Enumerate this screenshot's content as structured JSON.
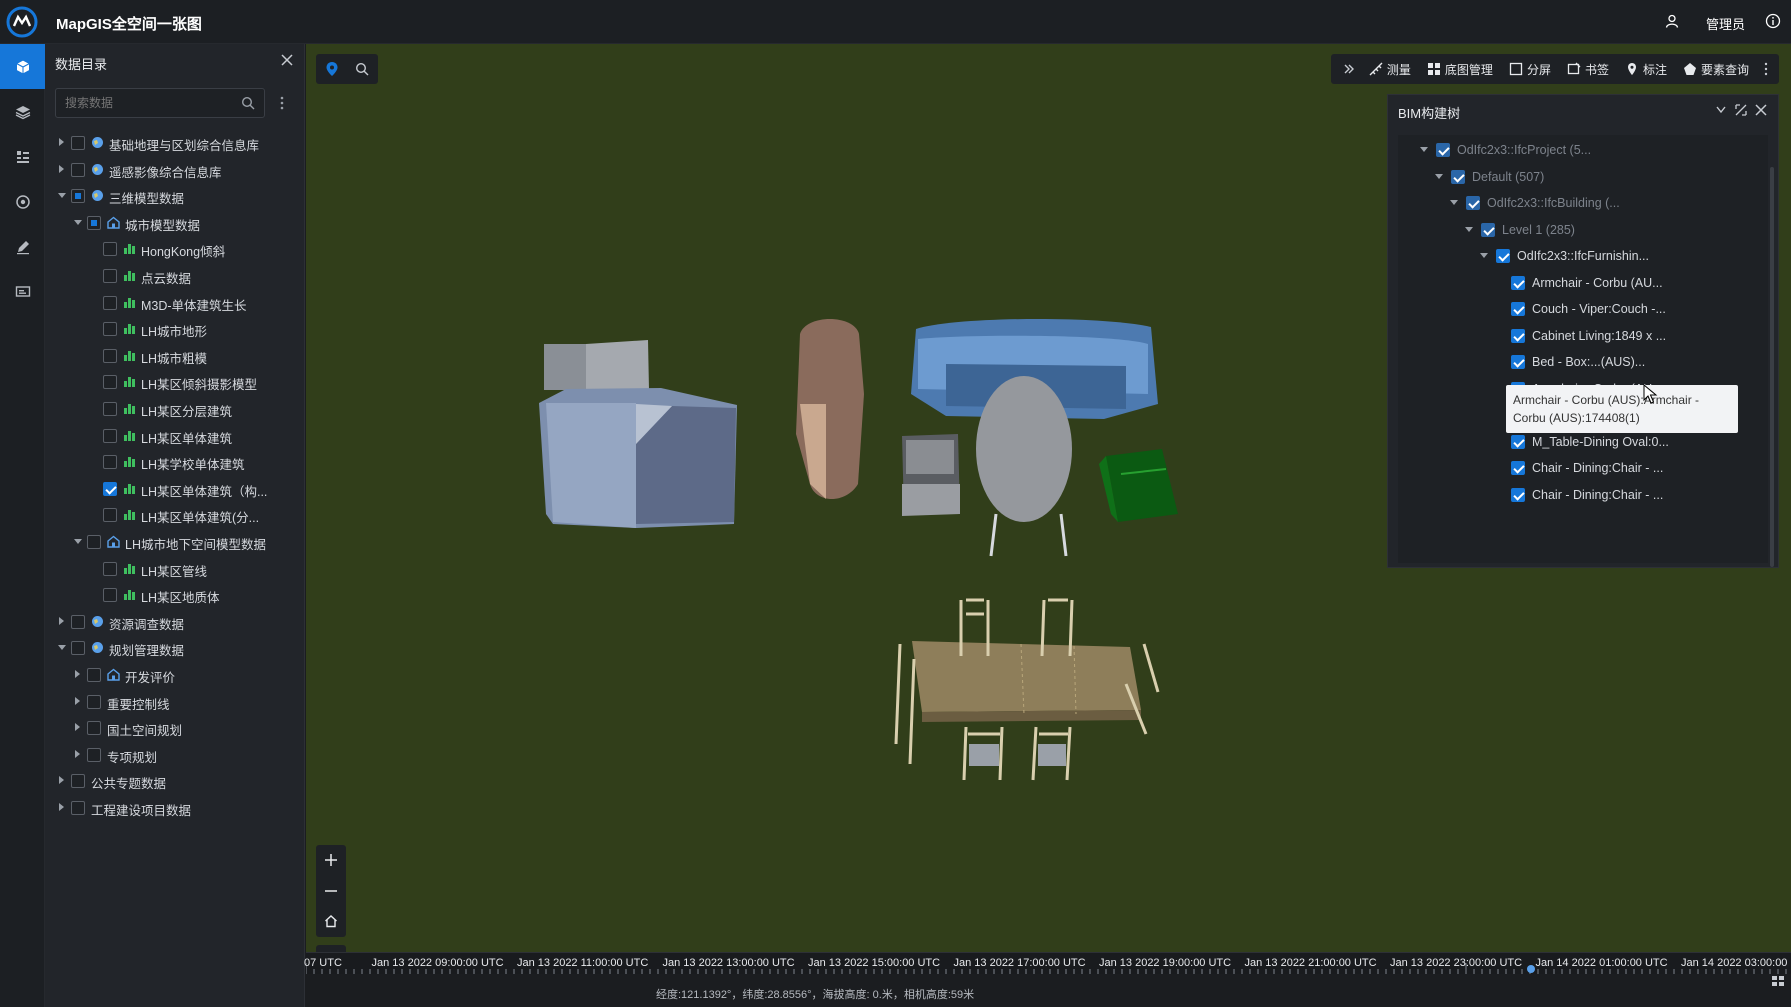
{
  "app": {
    "title": "MapGIS全空间一张图",
    "user": "管理员"
  },
  "panel": {
    "title": "数据目录",
    "search_placeholder": "搜索数据",
    "tree": [
      {
        "label": "基础地理与区划综合信息库",
        "level": 0,
        "arrow": "r",
        "check": "off",
        "icon": "globe"
      },
      {
        "label": "遥感影像综合信息库",
        "level": 0,
        "arrow": "r",
        "check": "off",
        "icon": "globe"
      },
      {
        "label": "三维模型数据",
        "level": 0,
        "arrow": "d",
        "check": "half",
        "icon": "globe"
      },
      {
        "label": "城市模型数据",
        "level": 1,
        "arrow": "d",
        "check": "half",
        "icon": "home"
      },
      {
        "label": "HongKong倾斜",
        "level": 2,
        "check": "off",
        "icon": "bar"
      },
      {
        "label": "点云数据",
        "level": 2,
        "check": "off",
        "icon": "bar"
      },
      {
        "label": "M3D-单体建筑生长",
        "level": 2,
        "check": "off",
        "icon": "bar"
      },
      {
        "label": "LH城市地形",
        "level": 2,
        "check": "off",
        "icon": "bar"
      },
      {
        "label": "LH城市粗模",
        "level": 2,
        "check": "off",
        "icon": "bar"
      },
      {
        "label": "LH某区倾斜摄影模型",
        "level": 2,
        "check": "off",
        "icon": "bar"
      },
      {
        "label": "LH某区分层建筑",
        "level": 2,
        "check": "off",
        "icon": "bar"
      },
      {
        "label": "LH某区单体建筑",
        "level": 2,
        "check": "off",
        "icon": "bar"
      },
      {
        "label": "LH某学校单体建筑",
        "level": 2,
        "check": "off",
        "icon": "bar"
      },
      {
        "label": "LH某区单体建筑（构...",
        "level": 2,
        "check": "on",
        "icon": "bar"
      },
      {
        "label": "LH某区单体建筑(分...",
        "level": 2,
        "check": "off",
        "icon": "bar"
      },
      {
        "label": "LH城市地下空间模型数据",
        "level": 1,
        "arrow": "d",
        "check": "off",
        "icon": "home"
      },
      {
        "label": "LH某区管线",
        "level": 2,
        "check": "off",
        "icon": "bar"
      },
      {
        "label": "LH某区地质体",
        "level": 2,
        "check": "off",
        "icon": "bar"
      },
      {
        "label": "资源调查数据",
        "level": 0,
        "arrow": "r",
        "check": "off",
        "icon": "globe"
      },
      {
        "label": "规划管理数据",
        "level": 0,
        "arrow": "d",
        "check": "off",
        "icon": "globe"
      },
      {
        "label": "开发评价",
        "level": 1,
        "arrow": "r",
        "check": "off",
        "icon": "home"
      },
      {
        "label": "重要控制线",
        "level": 1,
        "arrow": "r",
        "check": "off",
        "icon": ""
      },
      {
        "label": "国土空间规划",
        "level": 1,
        "arrow": "r",
        "check": "off",
        "icon": ""
      },
      {
        "label": "专项规划",
        "level": 1,
        "arrow": "r",
        "check": "off",
        "icon": ""
      },
      {
        "label": "公共专题数据",
        "level": 0,
        "arrow": "r",
        "check": "off",
        "icon": ""
      },
      {
        "label": "工程建设项目数据",
        "level": 0,
        "arrow": "r",
        "check": "off",
        "icon": ""
      }
    ]
  },
  "toolbar": {
    "items": [
      {
        "label": "测量",
        "icon": "measure-icon"
      },
      {
        "label": "底图管理",
        "icon": "basemap-icon"
      },
      {
        "label": "分屏",
        "icon": "split-screen-icon"
      },
      {
        "label": "书签",
        "icon": "bookmark-icon"
      },
      {
        "label": "标注",
        "icon": "marker-icon"
      },
      {
        "label": "要素查询",
        "icon": "query-icon"
      }
    ]
  },
  "bim": {
    "title": "BIM构建树",
    "rows": [
      {
        "label": "OdIfc2x3::IfcProject (5...",
        "level": 0,
        "dim": true
      },
      {
        "label": "Default (507)",
        "level": 1,
        "dim": true
      },
      {
        "label": "OdIfc2x3::IfcBuilding (...",
        "level": 2,
        "dim": true
      },
      {
        "label": "Level 1 (285)",
        "level": 3,
        "dim": true
      },
      {
        "label": "OdIfc2x3::IfcFurnishin...",
        "level": 4,
        "dim": false
      },
      {
        "label": "Armchair - Corbu (AU...",
        "level": 5,
        "dim": false
      },
      {
        "label": "Couch - Viper:Couch -...",
        "level": 5,
        "dim": false
      },
      {
        "label": "Cabinet Living:1849 x ...",
        "level": 5,
        "dim": false
      },
      {
        "label": "Bed - Box:...(AUS)...",
        "level": 5,
        "dim": false
      },
      {
        "label": "Armchair - Corbu (AU...",
        "level": 5,
        "dim": false
      },
      {
        "label": "Armchair - Corbu (AU...",
        "level": 5,
        "dim": false,
        "selected": true
      },
      {
        "label": "M_Table-Dining Oval:0...",
        "level": 5,
        "dim": false
      },
      {
        "label": "Chair - Dining:Chair - ...",
        "level": 5,
        "dim": false
      },
      {
        "label": "Chair - Dining:Chair - ...",
        "level": 5,
        "dim": false
      }
    ],
    "tooltip": "Armchair - Corbu (AUS):Armchair - Corbu (AUS):174408(1)"
  },
  "view_mode": "2D",
  "timeline": [
    "07 UTC",
    "Jan 13 2022 09:00:00 UTC",
    "Jan 13 2022 11:00:00 UTC",
    "Jan 13 2022 13:00:00 UTC",
    "Jan 13 2022 15:00:00 UTC",
    "Jan 13 2022 17:00:00 UTC",
    "Jan 13 2022 19:00:00 UTC",
    "Jan 13 2022 21:00:00 UTC",
    "Jan 13 2022 23:00:00 UTC",
    "Jan 14 2022 01:00:00 UTC",
    "Jan 14 2022 03:00:00"
  ],
  "status": "经度:121.1392°，纬度:28.8556°，海拔高度: 0.米，相机高度:59米",
  "colors": {
    "accent": "#1677d9",
    "map_bg": "#313e1a",
    "panel_bg": "#22252a"
  }
}
